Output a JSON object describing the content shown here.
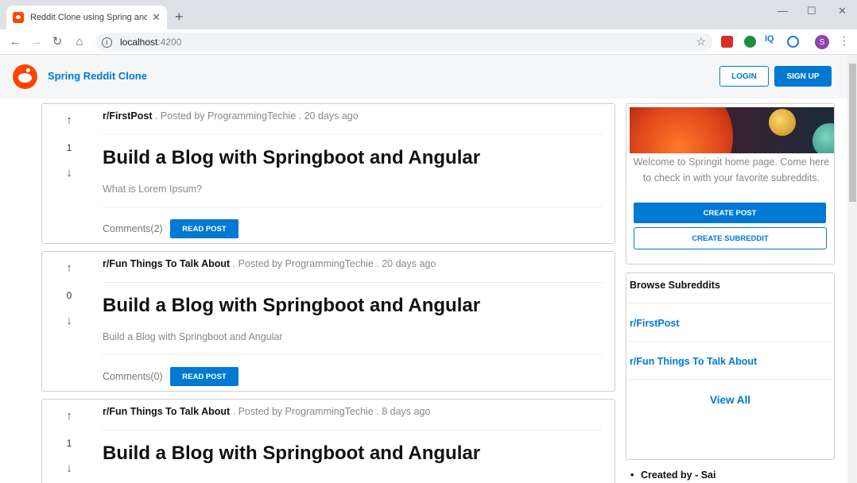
{
  "browser": {
    "tab_title": "Reddit Clone using Spring and A",
    "tab_close": "✕",
    "new_tab": "+",
    "url_host": "localhost",
    "url_port": ":4200",
    "profile_initial": "S",
    "ext_iq": "IQ",
    "minimize": "—",
    "maximize": "☐",
    "close": "✕"
  },
  "header": {
    "brand": "Spring Reddit Clone",
    "login": "LOGIN",
    "signup": "SIGN UP"
  },
  "posts": [
    {
      "subreddit": "r/FirstPost",
      "posted_by": " . Posted by ProgrammingTechie . 20 days ago",
      "votes": "1",
      "title": "Build a Blog with Springboot and Angular",
      "body": "What is Lorem Ipsum?",
      "comments": "Comments(2)",
      "read": "READ POST"
    },
    {
      "subreddit": "r/Fun Things To Talk About",
      "posted_by": " . Posted by ProgrammingTechie . 20 days ago",
      "votes": "0",
      "title": "Build a Blog with Springboot and Angular",
      "body": "Build a Blog with Springboot and Angular",
      "comments": "Comments(0)",
      "read": "READ POST"
    },
    {
      "subreddit": "r/Fun Things To Talk About",
      "posted_by": " . Posted by ProgrammingTechie . 8 days ago",
      "votes": "1",
      "title": "Build a Blog with Springboot and Angular",
      "body": "",
      "comments": "",
      "read": ""
    }
  ],
  "sidebar": {
    "welcome": "Welcome to Springit home page. Come here to check in with your favorite subreddits.",
    "create_post": "CREATE POST",
    "create_subreddit": "CREATE SUBREDDIT",
    "browse_title": "Browse Subreddits",
    "subreddits": [
      "r/FirstPost",
      "r/Fun Things To Talk About"
    ],
    "view_all": "View All"
  },
  "footer": {
    "created_by": "Created by - Sai"
  },
  "colors": {
    "accent": "#0079d3",
    "brand_orange": "#ff4500"
  }
}
